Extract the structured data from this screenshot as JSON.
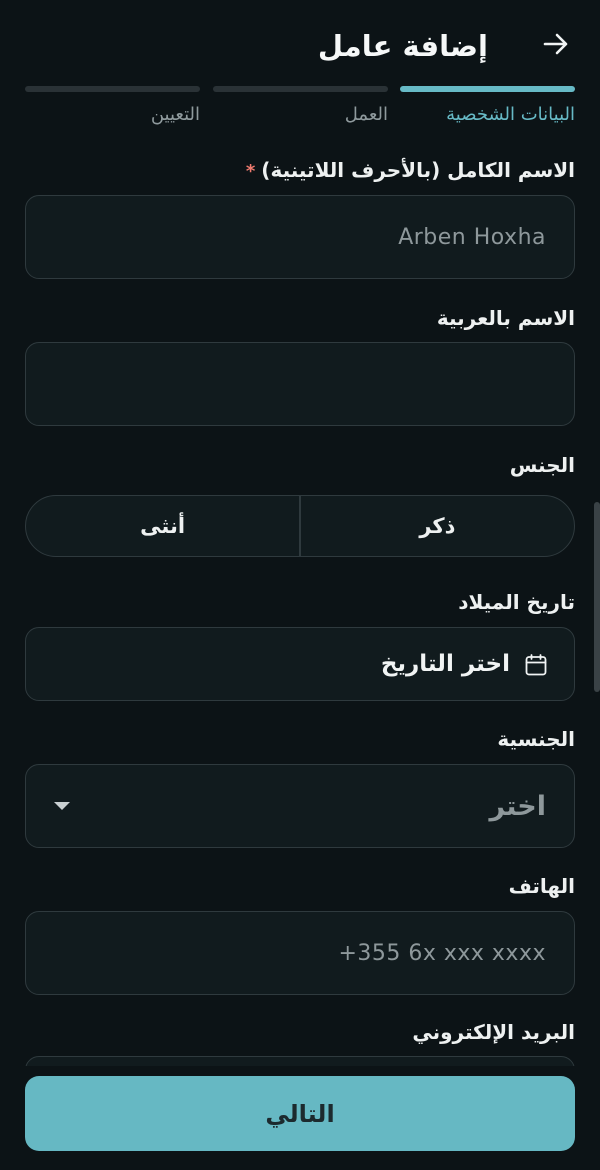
{
  "header": {
    "title": "إضافة عامل",
    "back_icon": "arrow-right-icon"
  },
  "stepper": {
    "steps": [
      {
        "label": "البيانات الشخصية",
        "active": true
      },
      {
        "label": "العمل",
        "active": false
      },
      {
        "label": "التعيين",
        "active": false
      }
    ]
  },
  "form": {
    "full_name": {
      "label": "الاسم الكامل (بالأحرف اللاتينية)",
      "required_mark": "*",
      "placeholder": "Arben Hoxha"
    },
    "arabic_name": {
      "label": "الاسم بالعربية",
      "value": ""
    },
    "gender": {
      "label": "الجنس",
      "options": [
        "ذكر",
        "أنثى"
      ]
    },
    "birth_date": {
      "label": "تاريخ الميلاد",
      "placeholder": "اختر التاريخ"
    },
    "nationality": {
      "label": "الجنسية",
      "placeholder": "اختر"
    },
    "phone": {
      "label": "الهاتف",
      "placeholder": "+355 6x xxx xxxx"
    },
    "email": {
      "label": "البريد الإلكتروني"
    }
  },
  "actions": {
    "next_label": "التالي"
  },
  "colors": {
    "background": "#0c1316",
    "accent": "#67bac6",
    "field_border": "#2f3a3e",
    "required": "#f07b6f"
  }
}
